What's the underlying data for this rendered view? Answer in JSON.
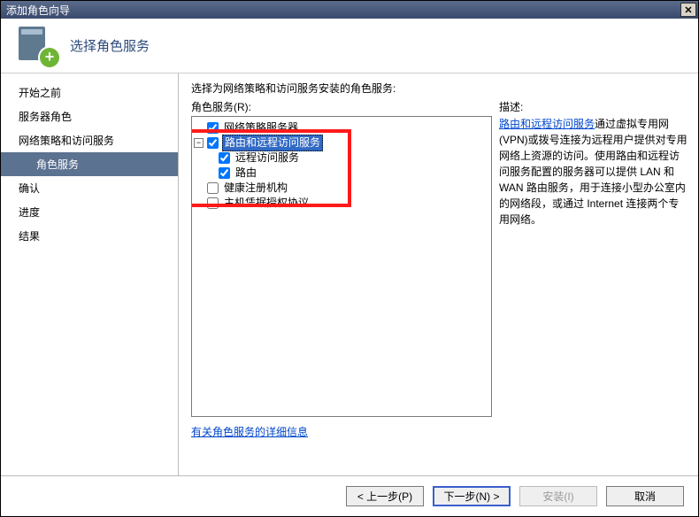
{
  "window": {
    "title": "添加角色向导"
  },
  "header": {
    "title": "选择角色服务"
  },
  "sidebar": {
    "items": [
      {
        "label": "开始之前"
      },
      {
        "label": "服务器角色"
      },
      {
        "label": "网络策略和访问服务"
      },
      {
        "label": "角色服务"
      },
      {
        "label": "确认"
      },
      {
        "label": "进度"
      },
      {
        "label": "结果"
      }
    ],
    "active_index": 3
  },
  "content": {
    "instruction": "选择为网络策略和访问服务安装的角色服务:",
    "tree_label": "角色服务(R):",
    "tree": [
      {
        "label": "网络策略服务器",
        "checked": true,
        "indent": 1,
        "expander": null
      },
      {
        "label": "路由和远程访问服务",
        "checked": true,
        "indent": 1,
        "expander": "-",
        "selected": true
      },
      {
        "label": "远程访问服务",
        "checked": true,
        "indent": 2,
        "expander": null
      },
      {
        "label": "路由",
        "checked": true,
        "indent": 2,
        "expander": null
      },
      {
        "label": "健康注册机构",
        "checked": false,
        "indent": 1,
        "expander": null,
        "obscured": true
      },
      {
        "label": "主机凭据授权协议",
        "checked": false,
        "indent": 1,
        "expander": null
      }
    ],
    "desc_label": "描述:",
    "desc_link": "路由和远程访问服务",
    "desc_rest": "通过虚拟专用网(VPN)或拨号连接为远程用户提供对专用网络上资源的访问。使用路由和远程访问服务配置的服务器可以提供 LAN 和 WAN 路由服务，用于连接小型办公室内的网络段，或通过 Internet 连接两个专用网络。",
    "more_link": "有关角色服务的详细信息"
  },
  "footer": {
    "prev": "< 上一步(P)",
    "next": "下一步(N) >",
    "install": "安装(I)",
    "cancel": "取消"
  }
}
